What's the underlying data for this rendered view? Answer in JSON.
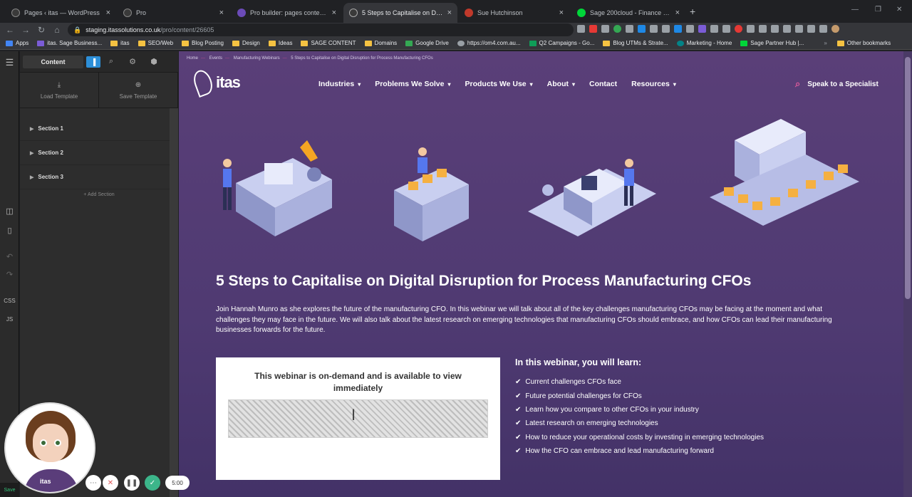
{
  "browser": {
    "tabs": [
      {
        "title": "Pages ‹ itas — WordPress",
        "active": false,
        "favicon_color": "#3a3a3a"
      },
      {
        "title": "Pro",
        "active": false,
        "favicon_color": "#3a3a3a"
      },
      {
        "title": "Pro builder: pages content disap",
        "active": false,
        "favicon_color": "#6b4bb8"
      },
      {
        "title": "5 Steps to Capitalise on Digital D",
        "active": true,
        "favicon_color": "#3a3a3a"
      },
      {
        "title": "Sue Hutchinson",
        "active": false,
        "favicon_color": "#c0392b"
      },
      {
        "title": "Sage 200cloud - Finance & Ma",
        "active": false,
        "favicon_color": "#00d639"
      }
    ],
    "new_tab": "+",
    "url_host": "staging.itassolutions.co.uk",
    "url_path": "/pro/content/26605",
    "bookmarks": [
      "Apps",
      "itas. Sage Business...",
      "itas",
      "SEO/Web",
      "Blog Posting",
      "Design",
      "Ideas",
      "SAGE CONTENT",
      "Domains",
      "Google Drive",
      "https://om4.com.au...",
      "Q2 Campaigns - Go...",
      "Blog UTMs & Strate...",
      "Marketing - Home",
      "Sage Partner Hub |...",
      "Other bookmarks"
    ]
  },
  "builder": {
    "content_tab": "Content",
    "load_template": "Load Template",
    "save_template": "Save Template",
    "sections": [
      "Section 1",
      "Section 2",
      "Section 3"
    ],
    "add_section": "Add Section",
    "rail_labels": [
      "CSS",
      "JS"
    ],
    "save": "Save"
  },
  "site": {
    "breadcrumb": [
      "Home",
      "Events",
      "Manufacturing Webinars",
      "5 Steps to Capitalise on Digital Disruption for Process Manufacturing CFOs"
    ],
    "logo_text": "itas",
    "nav": [
      {
        "label": "Industries",
        "dropdown": true
      },
      {
        "label": "Problems We Solve",
        "dropdown": true
      },
      {
        "label": "Products We Use",
        "dropdown": true
      },
      {
        "label": "About",
        "dropdown": true
      },
      {
        "label": "Contact",
        "dropdown": false
      },
      {
        "label": "Resources",
        "dropdown": true
      }
    ],
    "speak_cta": "Speak to a Specialist",
    "title": "5 Steps to Capitalise on Digital Disruption for Process Manufacturing CFOs",
    "intro": "Join Hannah Munro as she explores the future of the manufacturing CFO. In this webinar we will talk about all of the key challenges manufacturing CFOs may be facing at the moment and what challenges they may face in the future. We will also talk about the latest research on emerging technologies that manufacturing CFOs should embrace, and how CFOs can lead their manufacturing businesses forwards for the future.",
    "webinar_card_text": "This webinar is on-demand and is available to view immediately",
    "learn_heading": "In this webinar, you will learn:",
    "learn_items": [
      "Current challenges CFOs face",
      "Future potential challenges for CFOs",
      "Learn how you compare to other CFOs in your industry",
      "Latest research on emerging technologies",
      "How to reduce your operational costs by investing in emerging technologies",
      "How the CFO can embrace and lead manufacturing forward"
    ],
    "accent_color": "#e05a9c",
    "bg_color": "#553d76"
  },
  "recorder": {
    "timer": "5:00",
    "badge": "itas"
  }
}
